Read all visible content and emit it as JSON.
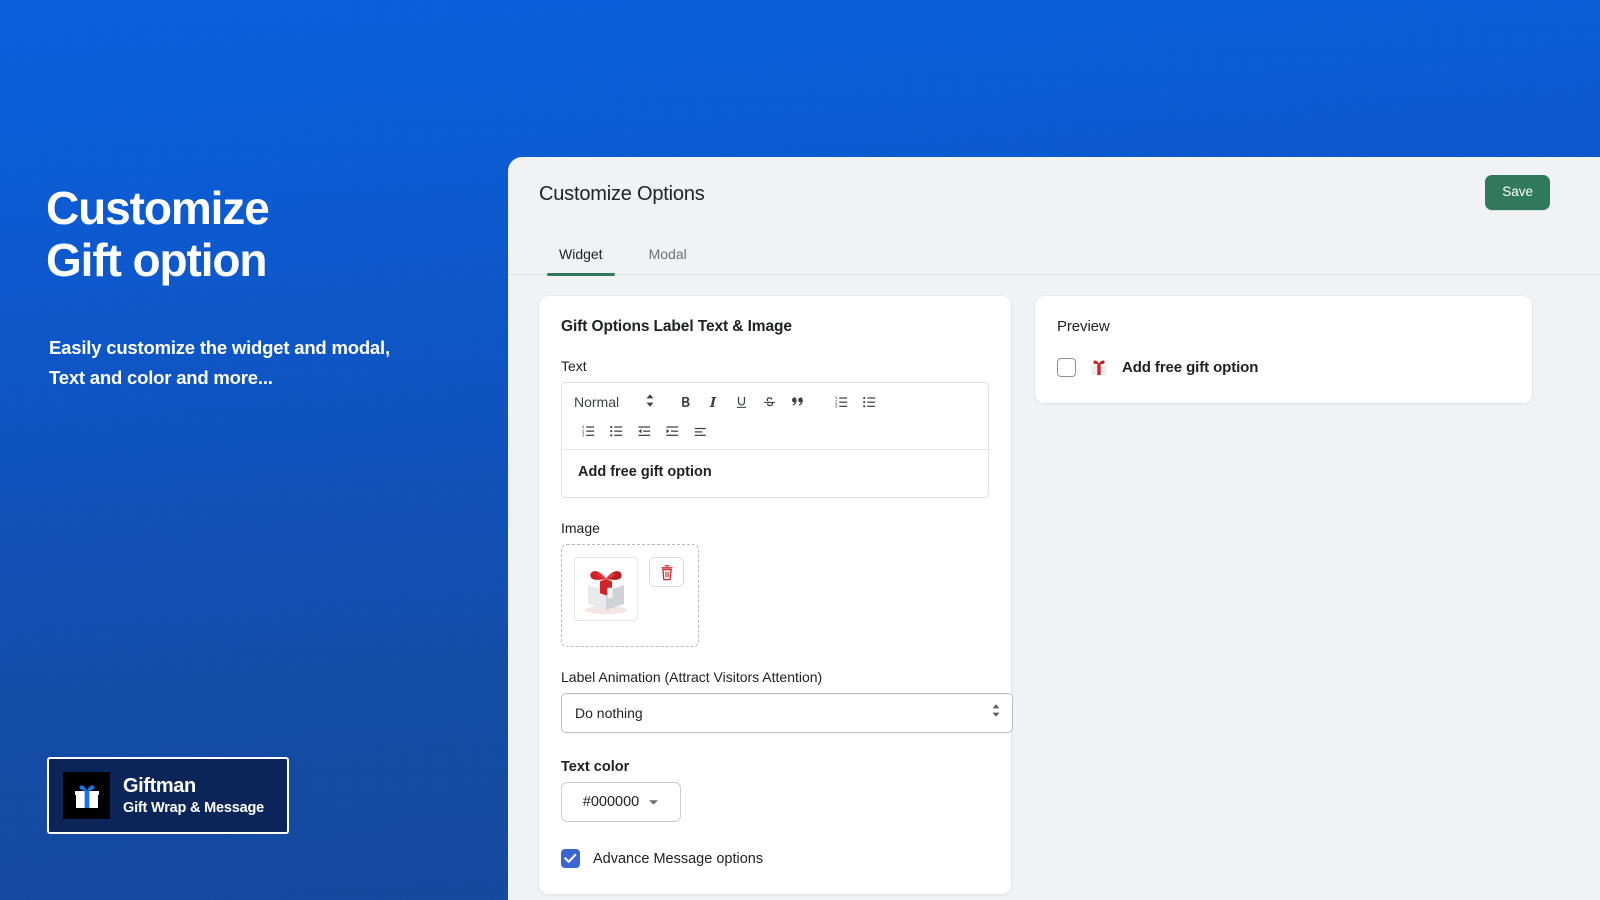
{
  "hero": {
    "title_line1": "Customize",
    "title_line2": "Gift option",
    "subtitle_line1": "Easily customize the widget and modal,",
    "subtitle_line2": "Text and color and more..."
  },
  "brand": {
    "name": "Giftman",
    "tagline": "Gift Wrap & Message",
    "logo_icon": "gift-box-icon"
  },
  "header": {
    "title": "Customize Options",
    "save_label": "Save"
  },
  "tabs": [
    {
      "label": "Widget",
      "active": true
    },
    {
      "label": "Modal",
      "active": false
    }
  ],
  "settings": {
    "card_title": "Gift Options Label Text & Image",
    "text_label": "Text",
    "editor": {
      "format_value": "Normal",
      "format_caret_icon": "updown-caret-icon",
      "toolbar_row1": [
        "bold-icon",
        "italic-icon",
        "underline-icon",
        "strikethrough-icon",
        "blockquote-icon",
        "ordered-list-icon",
        "bullet-list-icon"
      ],
      "toolbar_row2": [
        "ordered-list-icon",
        "bullet-list-icon",
        "outdent-icon",
        "indent-icon",
        "align-left-icon"
      ],
      "content": "Add free gift option"
    },
    "image_label": "Image",
    "image_thumb_icon": "gift-box-red-ribbon-icon",
    "image_delete_icon": "trash-icon",
    "animation_label": "Label Animation (Attract Visitors Attention)",
    "animation_value": "Do nothing",
    "text_color_label": "Text color",
    "text_color_value": "#000000",
    "advance_label": "Advance Message options",
    "advance_checked": true
  },
  "preview": {
    "title": "Preview",
    "checkbox_checked": false,
    "gift_icon": "gift-emoji-icon",
    "label": "Add free gift option"
  },
  "colors": {
    "accent_green": "#31795e",
    "tab_underline": "#2f7a5b",
    "checkbox_blue": "#3b66d0",
    "panel_bg": "#f1f2f4",
    "brand_navy": "#0b2559",
    "bg_blue_top": "#0a5fdd",
    "bg_blue_bottom": "#14489a",
    "delete_red": "#cf2b2b"
  }
}
